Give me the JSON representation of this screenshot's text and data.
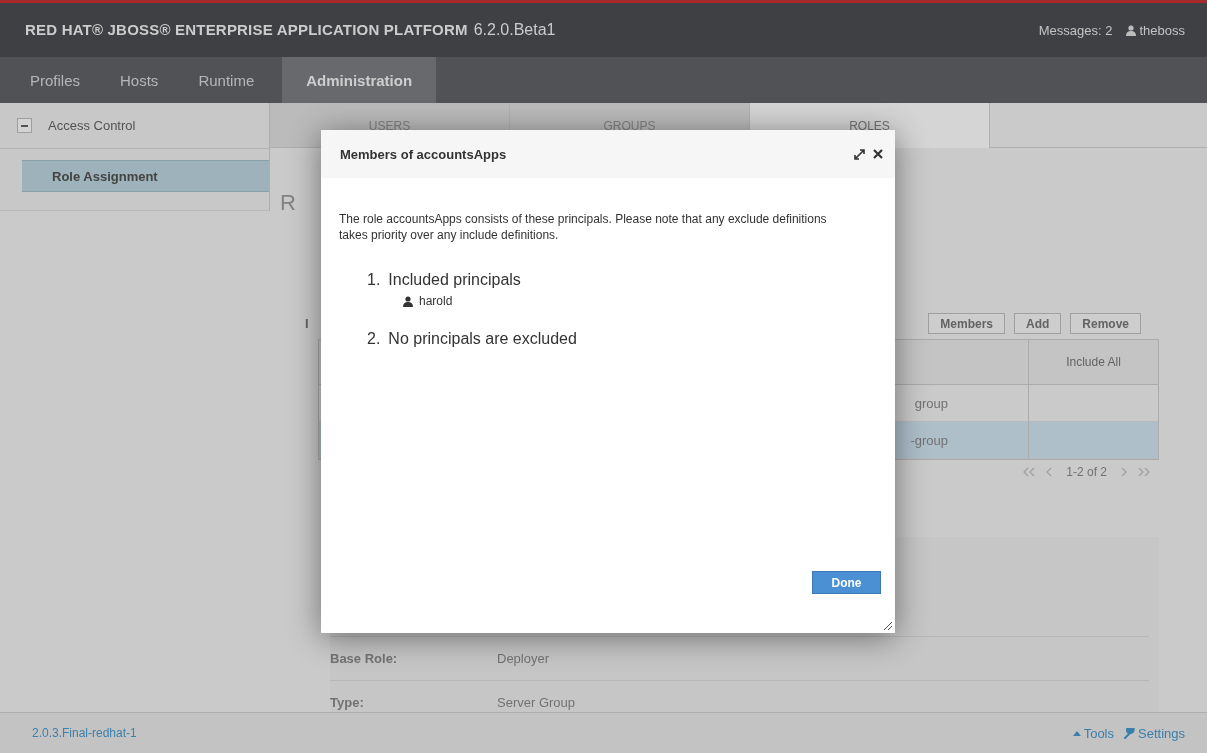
{
  "header": {
    "brand": "RED HAT® JBOSS® ENTERPRISE APPLICATION PLATFORM",
    "version": "6.2.0.Beta1",
    "messages": "Messages: 2",
    "user": "theboss"
  },
  "nav": [
    {
      "label": "Profiles",
      "selected": false
    },
    {
      "label": "Hosts",
      "selected": false
    },
    {
      "label": "Runtime",
      "selected": false
    },
    {
      "label": "Administration",
      "selected": true
    }
  ],
  "sidebar": {
    "groups": [
      {
        "label": "Access Control",
        "expanded": true,
        "items": [
          {
            "label": "Role Assignment",
            "selected": true
          }
        ]
      }
    ]
  },
  "content": {
    "tabs": [
      {
        "label": "USERS",
        "selected": false
      },
      {
        "label": "GROUPS",
        "selected": false
      },
      {
        "label": "ROLES",
        "selected": true
      }
    ],
    "heading": "R",
    "subheading": "I",
    "buttons": [
      "Members",
      "Add",
      "Remove"
    ],
    "table": {
      "columns": [
        "Include All"
      ],
      "rows": [
        {
          "name": "group",
          "selected": false
        },
        {
          "name": "-group",
          "selected": true
        }
      ]
    },
    "pager": "1-2 of 2",
    "details": [
      {
        "label": "Base Role:",
        "value": "Deployer"
      },
      {
        "label": "Type:",
        "value": "Server Group"
      }
    ]
  },
  "dialog": {
    "title": "Members of accountsApps",
    "text": "The role accountsApps consists of these principals. Please note that any exclude definitions takes priority over any include definitions.",
    "sections": [
      {
        "number": "1.",
        "title": "Included principals",
        "principals": [
          "harold"
        ]
      },
      {
        "number": "2.",
        "title": "No principals are excluded"
      }
    ],
    "button": "Done"
  },
  "footer": {
    "version": "2.0.3.Final-redhat-1",
    "tools": "Tools",
    "settings": "Settings"
  }
}
